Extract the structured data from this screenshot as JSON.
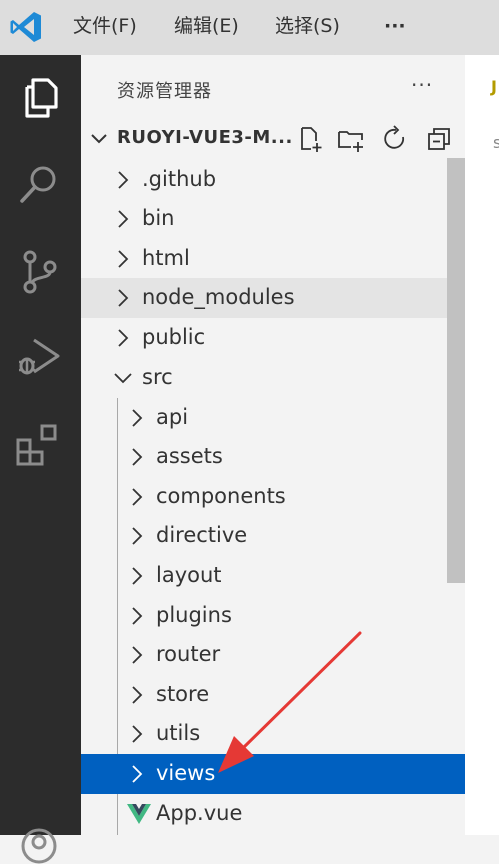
{
  "menu": {
    "file": "文件(F)",
    "edit": "编辑(E)",
    "selection": "选择(S)",
    "more": "···"
  },
  "explorer": {
    "title": "资源管理器",
    "more": "···",
    "project_name": "RUOYI-VUE3-M...",
    "items": [
      {
        "label": ".github"
      },
      {
        "label": "bin"
      },
      {
        "label": "html"
      },
      {
        "label": "node_modules"
      },
      {
        "label": "public"
      },
      {
        "label": "src"
      },
      {
        "label": "api"
      },
      {
        "label": "assets"
      },
      {
        "label": "components"
      },
      {
        "label": "directive"
      },
      {
        "label": "layout"
      },
      {
        "label": "plugins"
      },
      {
        "label": "router"
      },
      {
        "label": "store"
      },
      {
        "label": "utils"
      },
      {
        "label": "views"
      },
      {
        "label": "App.vue"
      }
    ]
  },
  "editor": {
    "tab_text": "J",
    "line_text": "s"
  },
  "colors": {
    "activity_bar": "#2c2c2c",
    "selection": "#0060c0",
    "vs_logo": "#1e8ad6",
    "vue_green": "#41b883",
    "vue_dark": "#35495e",
    "annotation_arrow": "#e53935"
  }
}
